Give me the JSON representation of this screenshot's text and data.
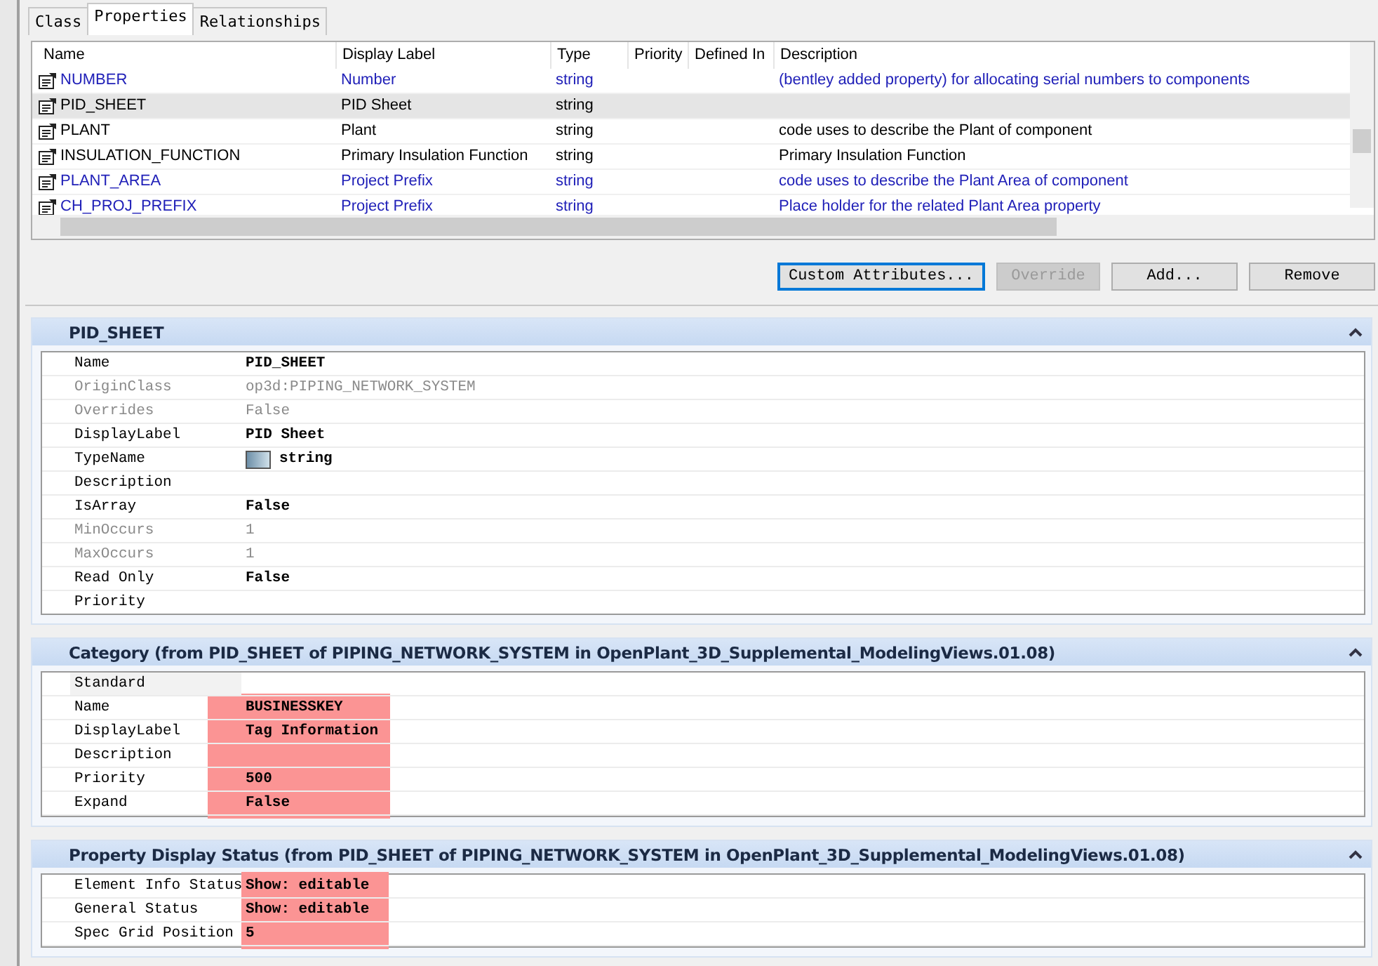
{
  "tabs": [
    {
      "label": "Class",
      "selected": false
    },
    {
      "label": "Properties",
      "selected": true
    },
    {
      "label": "Relationships",
      "selected": false
    }
  ],
  "property_list": {
    "columns": [
      "Name",
      "Display Label",
      "Type",
      "Priority",
      "Defined In",
      "Description"
    ],
    "rows": [
      {
        "name": "NUMBER",
        "display_label": "Number",
        "type": "string",
        "description": "(bentley added property) for allocating serial numbers to components",
        "inherited": true,
        "selected": false
      },
      {
        "name": "PID_SHEET",
        "display_label": "PID Sheet",
        "type": "string",
        "description": "",
        "inherited": false,
        "selected": true
      },
      {
        "name": "PLANT",
        "display_label": "Plant",
        "type": "string",
        "description": "code uses to describe the Plant of component",
        "inherited": false,
        "selected": false
      },
      {
        "name": "INSULATION_FUNCTION",
        "display_label": "Primary Insulation Function",
        "type": "string",
        "description": "Primary Insulation Function",
        "inherited": false,
        "selected": false
      },
      {
        "name": "PLANT_AREA",
        "display_label": "Project Prefix",
        "type": "string",
        "description": "code uses to describe the Plant Area of component",
        "inherited": true,
        "selected": false
      },
      {
        "name": "CH_PROJ_PREFIX",
        "display_label": "Project Prefix",
        "type": "string",
        "description": "Place holder for the related Plant Area property",
        "inherited": true,
        "selected": false
      }
    ]
  },
  "buttons": [
    {
      "label": "Custom Attributes...",
      "disabled": false,
      "focused": true
    },
    {
      "label": "Override",
      "disabled": true,
      "focused": false
    },
    {
      "label": "Add...",
      "disabled": false,
      "focused": false
    },
    {
      "label": "Remove",
      "disabled": false,
      "focused": false
    }
  ],
  "sections": [
    {
      "title": "PID_SHEET",
      "expanded": true,
      "rows": [
        {
          "label": "Name",
          "value": "PID_SHEET",
          "disabled": false,
          "marked": false
        },
        {
          "label": "OriginClass",
          "value": "op3d:PIPING_NETWORK_SYSTEM",
          "disabled": true,
          "marked": false
        },
        {
          "label": "Overrides",
          "value": "False",
          "disabled": true,
          "marked": false
        },
        {
          "label": "DisplayLabel",
          "value": "PID Sheet",
          "disabled": false,
          "marked": false
        },
        {
          "label": "TypeName",
          "value": "string",
          "kind": "type",
          "disabled": false,
          "marked": false
        },
        {
          "label": "Description",
          "disabled": false,
          "marked": false
        },
        {
          "label": "IsArray",
          "value": "False",
          "disabled": false,
          "marked": false
        },
        {
          "label": "MinOccurs",
          "value": "1",
          "disabled": true,
          "marked": false
        },
        {
          "label": "MaxOccurs",
          "value": "1",
          "disabled": true,
          "marked": false
        },
        {
          "label": "Read Only",
          "value": "False",
          "disabled": false,
          "marked": false
        },
        {
          "label": "Priority",
          "disabled": false,
          "marked": false
        }
      ]
    },
    {
      "title": "Category (from PID_SHEET of PIPING_NETWORK_SYSTEM in OpenPlant_3D_Supplemental_ModelingViews.01.08)",
      "expanded": true,
      "rows": [
        {
          "label": "Standard",
          "kind": "group",
          "disabled": false,
          "marked": false
        },
        {
          "label": "Name",
          "value": "BUSINESSKEY",
          "disabled": false,
          "marked": true
        },
        {
          "label": "DisplayLabel",
          "value": "Tag Information",
          "disabled": false,
          "marked": true
        },
        {
          "label": "Description",
          "disabled": false,
          "marked": true
        },
        {
          "label": "Priority",
          "value": "500",
          "disabled": false,
          "marked": true
        },
        {
          "label": "Expand",
          "value": "False",
          "disabled": false,
          "marked": true
        }
      ]
    },
    {
      "title": "Property Display Status (from PID_SHEET of PIPING_NETWORK_SYSTEM in OpenPlant_3D_Supplemental_ModelingViews.01.08)",
      "expanded": true,
      "rows": [
        {
          "label": "Element Info Status",
          "value": "Show: editable",
          "disabled": false,
          "marked": true
        },
        {
          "label": "General Status",
          "value": "Show: editable",
          "disabled": false,
          "marked": true
        },
        {
          "label": "Spec Grid Position",
          "value": "5",
          "disabled": false,
          "marked": true
        }
      ]
    }
  ]
}
